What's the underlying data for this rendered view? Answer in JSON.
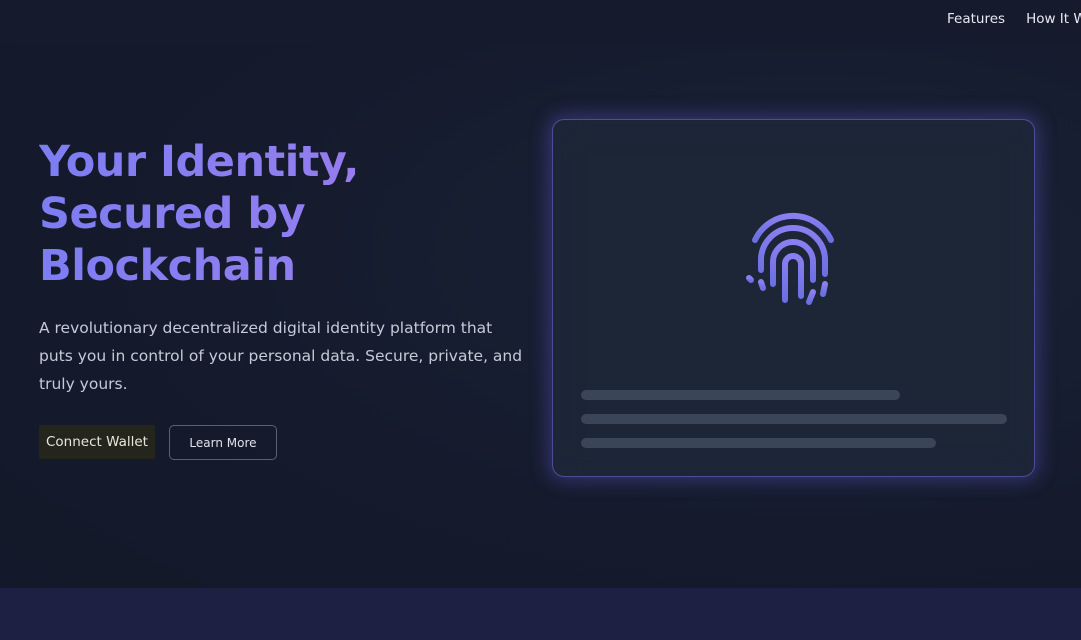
{
  "nav": {
    "links": [
      "Features",
      "How It Wo"
    ]
  },
  "hero": {
    "title_lines": [
      "Your Identity,",
      "Secured by",
      "Blockchain"
    ],
    "description": "A revolutionary decentralized digital identity platform that puts you in control of your personal data. Secure, private, and truly yours.",
    "primary_button": "Connect Wallet",
    "secondary_button": "Learn More"
  },
  "card": {
    "icon": "fingerprint-icon"
  },
  "colors": {
    "background": "#141a2c",
    "title_gradient_start": "#7d7df2",
    "title_gradient_end": "#a875e8",
    "card_glow": "#6e60e6",
    "fingerprint": "#7b76e6"
  }
}
